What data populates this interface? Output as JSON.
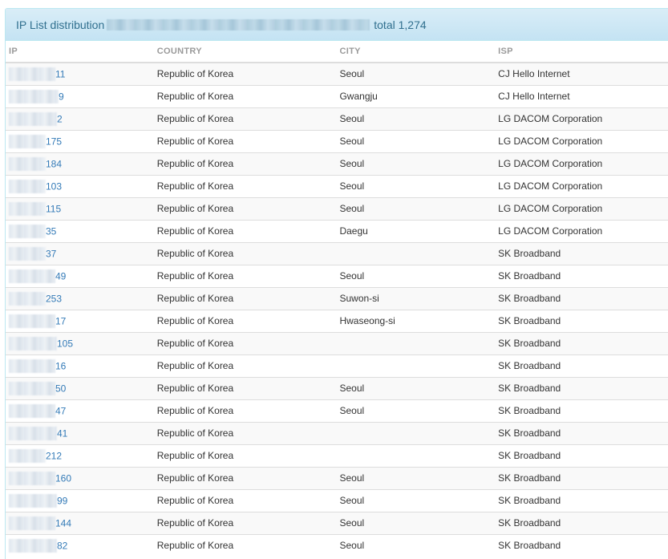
{
  "panel": {
    "title": "IP List distribution",
    "total": "total 1,274"
  },
  "columns": {
    "ip": "IP",
    "country": "COUNTRY",
    "city": "CITY",
    "isp": "ISP"
  },
  "rows": [
    {
      "ip_suffix": "11",
      "country": "Republic of Korea",
      "city": "Seoul",
      "isp": "CJ Hello Internet"
    },
    {
      "ip_suffix": "9",
      "country": "Republic of Korea",
      "city": "Gwangju",
      "isp": "CJ Hello Internet"
    },
    {
      "ip_suffix": "2",
      "country": "Republic of Korea",
      "city": "Seoul",
      "isp": "LG DACOM Corporation"
    },
    {
      "ip_suffix": "175",
      "country": "Republic of Korea",
      "city": "Seoul",
      "isp": "LG DACOM Corporation"
    },
    {
      "ip_suffix": "184",
      "country": "Republic of Korea",
      "city": "Seoul",
      "isp": "LG DACOM Corporation"
    },
    {
      "ip_suffix": "103",
      "country": "Republic of Korea",
      "city": "Seoul",
      "isp": "LG DACOM Corporation"
    },
    {
      "ip_suffix": "115",
      "country": "Republic of Korea",
      "city": "Seoul",
      "isp": "LG DACOM Corporation"
    },
    {
      "ip_suffix": "35",
      "country": "Republic of Korea",
      "city": "Daegu",
      "isp": "LG DACOM Corporation"
    },
    {
      "ip_suffix": "37",
      "country": "Republic of Korea",
      "city": "",
      "isp": "SK Broadband"
    },
    {
      "ip_suffix": "49",
      "country": "Republic of Korea",
      "city": "Seoul",
      "isp": "SK Broadband"
    },
    {
      "ip_suffix": "253",
      "country": "Republic of Korea",
      "city": "Suwon-si",
      "isp": "SK Broadband"
    },
    {
      "ip_suffix": "17",
      "country": "Republic of Korea",
      "city": "Hwaseong-si",
      "isp": "SK Broadband"
    },
    {
      "ip_suffix": "105",
      "country": "Republic of Korea",
      "city": "",
      "isp": "SK Broadband"
    },
    {
      "ip_suffix": "16",
      "country": "Republic of Korea",
      "city": "",
      "isp": "SK Broadband"
    },
    {
      "ip_suffix": "50",
      "country": "Republic of Korea",
      "city": "Seoul",
      "isp": "SK Broadband"
    },
    {
      "ip_suffix": "47",
      "country": "Republic of Korea",
      "city": "Seoul",
      "isp": "SK Broadband"
    },
    {
      "ip_suffix": "41",
      "country": "Republic of Korea",
      "city": "",
      "isp": "SK Broadband"
    },
    {
      "ip_suffix": "212",
      "country": "Republic of Korea",
      "city": "",
      "isp": "SK Broadband"
    },
    {
      "ip_suffix": "160",
      "country": "Republic of Korea",
      "city": "Seoul",
      "isp": "SK Broadband"
    },
    {
      "ip_suffix": "99",
      "country": "Republic of Korea",
      "city": "Seoul",
      "isp": "SK Broadband"
    },
    {
      "ip_suffix": "144",
      "country": "Republic of Korea",
      "city": "Seoul",
      "isp": "SK Broadband"
    },
    {
      "ip_suffix": "82",
      "country": "Republic of Korea",
      "city": "Seoul",
      "isp": "SK Broadband"
    }
  ],
  "colors": {
    "heading_text": "#31708f",
    "heading_bg": "#d9edf7",
    "link": "#337ab7",
    "row_stripe": "#f9f9f9",
    "border": "#dddddd"
  }
}
